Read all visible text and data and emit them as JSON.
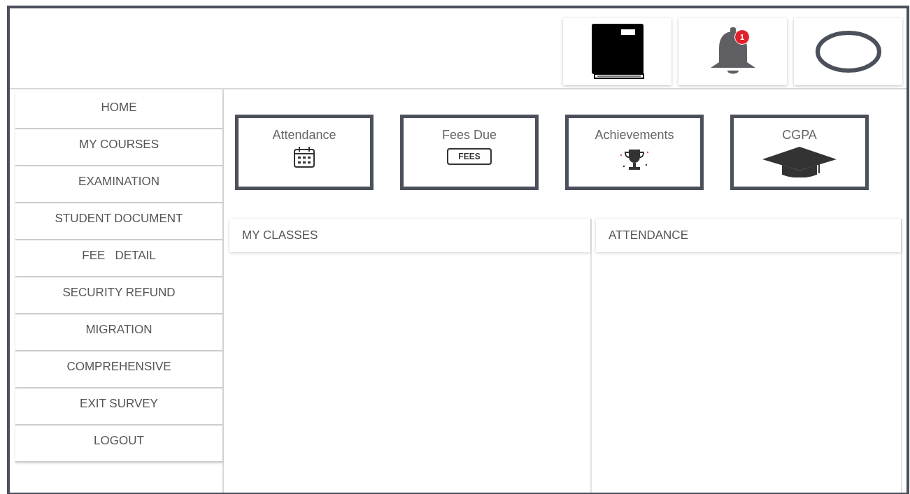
{
  "header": {
    "notifications": {
      "badge": "1"
    }
  },
  "sidebar": {
    "items": [
      {
        "label": "HOME"
      },
      {
        "label": "MY COURSES"
      },
      {
        "label": "EXAMINATION"
      },
      {
        "label": "STUDENT DOCUMENT"
      },
      {
        "label": "FEE   DETAIL"
      },
      {
        "label": "SECURITY REFUND"
      },
      {
        "label": "MIGRATION"
      },
      {
        "label": "COMPREHENSIVE"
      },
      {
        "label": "EXIT SURVEY"
      },
      {
        "label": "LOGOUT"
      }
    ]
  },
  "cards": [
    {
      "label": "Attendance",
      "kind": "calendar"
    },
    {
      "label": "Fees Due",
      "kind": "fees",
      "tag_text": "FEES"
    },
    {
      "label": "Achievements",
      "kind": "trophy"
    },
    {
      "label": "CGPA",
      "kind": "cap"
    }
  ],
  "panels": [
    {
      "title": "MY CLASSES"
    },
    {
      "title": "ATTENDANCE"
    }
  ]
}
